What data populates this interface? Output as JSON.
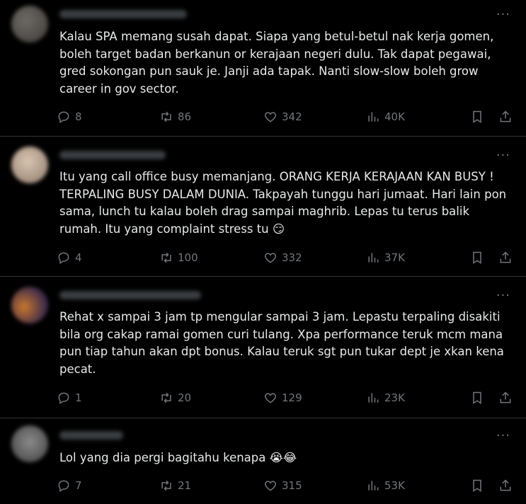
{
  "more_glyph": "···",
  "posts": [
    {
      "text": "Kalau SPA memang susah dapat. Siapa yang betul-betul nak kerja gomen, boleh target badan berkanun or kerajaan negeri dulu. Tak dapat pegawai, gred sokongan pun sauk je. Janji ada tapak. Nanti slow-slow boleh grow career in gov sector.",
      "replies": "8",
      "retweets": "86",
      "likes": "342",
      "views": "40K"
    },
    {
      "text": "Itu yang call office busy memanjang. ORANG KERJA KERAJAAN KAN BUSY ! TERPALING BUSY DALAM DUNIA. Takpayah tunggu hari jumaat. Hari lain pon sama, lunch tu kalau boleh drag sampai maghrib. Lepas tu terus balik rumah. Itu yang complaint stress tu 😏",
      "replies": "4",
      "retweets": "100",
      "likes": "332",
      "views": "37K"
    },
    {
      "text": "Rehat x sampai 3 jam tp mengular sampai 3 jam. Lepastu terpaling disakiti bila org cakap ramai gomen curi tulang. Xpa performance teruk mcm mana pun tiap tahun akan dpt bonus. Kalau teruk sgt pun tukar dept je xkan kena pecat.",
      "replies": "1",
      "retweets": "20",
      "likes": "129",
      "views": "23K"
    },
    {
      "text": "Lol yang dia pergi bagitahu kenapa 😭😂",
      "replies": "7",
      "retweets": "21",
      "likes": "315",
      "views": "53K"
    }
  ]
}
